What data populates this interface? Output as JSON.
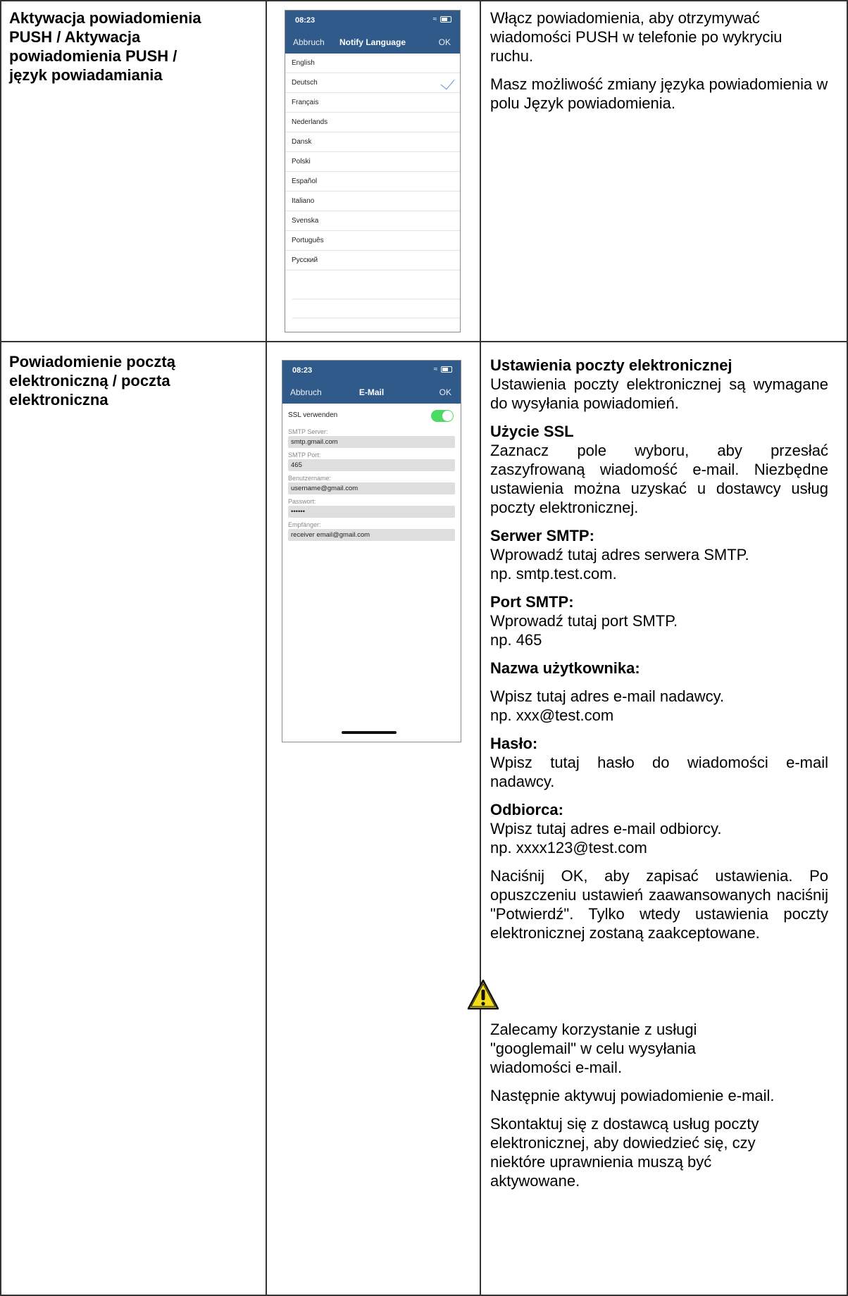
{
  "rows": [
    {
      "label": "Aktywacja powiadomienia\nPUSH / Aktywacja\npowiadomienia PUSH /\njęzyk powiadamiania",
      "phone": {
        "time": "08:23",
        "nav_left": "Abbruch",
        "nav_title": "Notify Language",
        "nav_right": "OK",
        "languages": [
          "English",
          "Deutsch",
          "Français",
          "Nederlands",
          "Dansk",
          "Polski",
          "Español",
          "Italiano",
          "Svenska",
          "Português",
          "Русский"
        ],
        "selected": "Deutsch"
      },
      "paragraphs": [
        "Włącz powiadomienia, aby otrzymywać wiadomości PUSH w telefonie po wykryciu ruchu.",
        "Masz możliwość zmiany języka powiadomienia w polu Język powiadomienia."
      ]
    },
    {
      "label": "Powiadomienie pocztą\nelektroniczną / poczta\nelektroniczna",
      "phone": {
        "time": "08:23",
        "nav_left": "Abbruch",
        "nav_title": "E-Mail",
        "nav_right": "OK",
        "ssl_label": "SSL verwenden",
        "ssl_on": true,
        "fields": [
          {
            "label": "SMTP Server:",
            "value": "smtp.gmail.com"
          },
          {
            "label": "SMTP Port:",
            "value": "465"
          },
          {
            "label": "Benutzername:",
            "value": "username@gmail.com"
          },
          {
            "label": "Passwort:",
            "value": "••••••"
          },
          {
            "label": "Empfänger:",
            "value": "receiver email@gmail.com"
          }
        ]
      },
      "sections": [
        {
          "heading": "Ustawienia poczty elektronicznej",
          "text": "Ustawienia poczty elektronicznej są wymagane do wysyłania powiadomień."
        },
        {
          "heading": "Użycie SSL",
          "text": "Zaznacz pole wyboru, aby przesłać zaszyfrowaną wiadomość e-mail. Niezbędne ustawienia można uzyskać u dostawcy usług poczty elektronicznej."
        },
        {
          "heading": "Serwer SMTP:",
          "text": "Wprowadź tutaj adres serwera SMTP.\nnp. smtp.test.com."
        },
        {
          "heading": "Port SMTP:",
          "text": "Wprowadź tutaj port SMTP.\nnp. 465"
        },
        {
          "heading": "Nazwa użytkownika:",
          "text": ""
        },
        {
          "heading": "",
          "text": "Wpisz tutaj adres e-mail nadawcy.\nnp. xxx@test.com"
        },
        {
          "heading": "Hasło:",
          "text": "Wpisz tutaj hasło do wiadomości e-mail nadawcy."
        },
        {
          "heading": "Odbiorca:",
          "text": "Wpisz tutaj adres e-mail odbiorcy.\nnp. xxxx123@test.com"
        },
        {
          "heading": "",
          "text": "Naciśnij OK, aby zapisać ustawienia. Po opuszczeniu ustawień zaawansowanych naciśnij \"Potwierdź\". Tylko wtedy ustawienia poczty elektronicznej zostaną zaakceptowane."
        }
      ],
      "warning_icon": "warning-triangle-icon",
      "after_warning": [
        "Zalecamy korzystanie z usługi\n\"googlemail\" w celu wysyłania\nwiadomości e-mail.",
        "Następnie aktywuj powiadomienie e-mail.",
        "Skontaktuj się z dostawcą usług poczty\nelektronicznej, aby dowiedzieć się, czy\nniektóre uprawnienia muszą być\naktywowane."
      ]
    }
  ],
  "colors": {
    "nav": "#2f5a8a",
    "toggle": "#4cd964",
    "check": "#5b8fd6",
    "warning": "#f2dc1b"
  }
}
